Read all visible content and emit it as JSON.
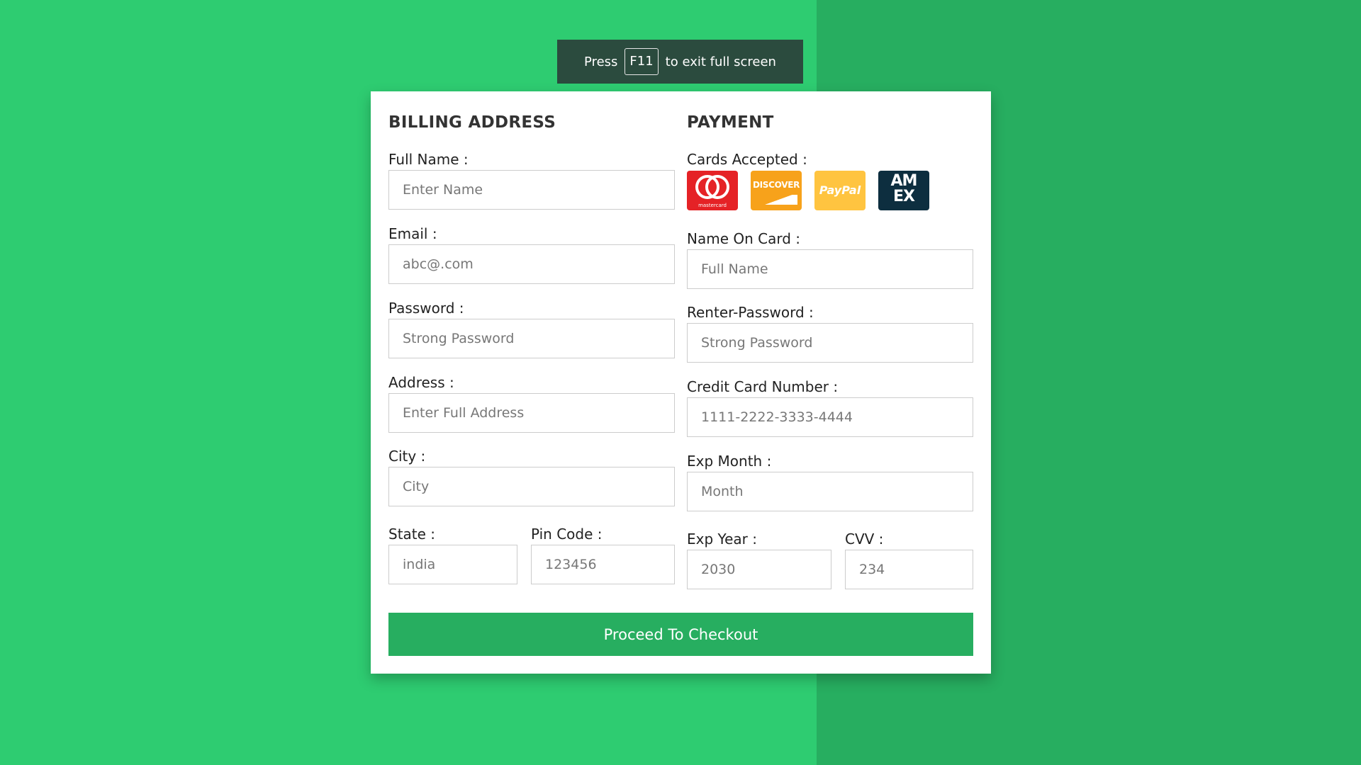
{
  "fullscreen_notice": {
    "before": "Press",
    "key": "F11",
    "after": "to exit full screen"
  },
  "billing": {
    "title": "BILLING ADDRESS",
    "full_name": {
      "label": "Full Name :",
      "placeholder": "Enter Name"
    },
    "email": {
      "label": "Email :",
      "placeholder": "abc@.com"
    },
    "password": {
      "label": "Password :",
      "placeholder": "Strong Password"
    },
    "address": {
      "label": "Address :",
      "placeholder": "Enter Full Address"
    },
    "city": {
      "label": "City :",
      "placeholder": "City"
    },
    "state": {
      "label": "State :",
      "placeholder": "india"
    },
    "pin_code": {
      "label": "Pin Code :",
      "placeholder": "123456"
    }
  },
  "payment": {
    "title": "PAYMENT",
    "cards_accepted_label": "Cards Accepted :",
    "cards": [
      {
        "name": "mastercard",
        "text": "mastercard",
        "icon": "mastercard-icon",
        "color": "#e52226"
      },
      {
        "name": "discover",
        "text": "DISCOVER",
        "icon": "discover-icon",
        "color": "#f7a21b"
      },
      {
        "name": "paypal",
        "text": "PayPal",
        "icon": "paypal-icon",
        "color": "#ffc440"
      },
      {
        "name": "amex",
        "text": "AM EX",
        "icon": "amex-icon",
        "color": "#0d2e3f"
      }
    ],
    "name_on_card": {
      "label": "Name On Card :",
      "placeholder": "Full Name"
    },
    "renter_password": {
      "label": "Renter-Password :",
      "placeholder": "Strong Password"
    },
    "card_number": {
      "label": "Credit Card Number :",
      "placeholder": "1111-2222-3333-4444"
    },
    "exp_month": {
      "label": "Exp Month :",
      "placeholder": "Month"
    },
    "exp_year": {
      "label": "Exp Year :",
      "placeholder": "2030"
    },
    "cvv": {
      "label": "CVV :",
      "placeholder": "234"
    }
  },
  "checkout_button": "Proceed To Checkout",
  "colors": {
    "background_left": "#2ecc71",
    "background_right": "#27ae60",
    "button": "#27ae60",
    "toast": "#2b4b3e"
  }
}
